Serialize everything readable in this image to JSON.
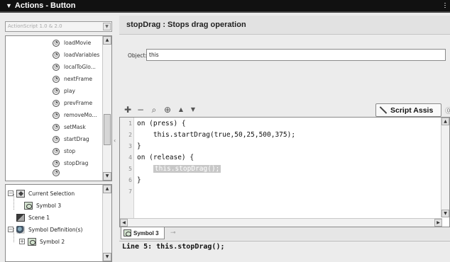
{
  "panel": {
    "title": "Actions - Button"
  },
  "version_select": {
    "value": "ActionScript 1.0 & 2.0"
  },
  "actions_list": {
    "items": [
      "loadMovie",
      "loadVariables",
      "localToGlo...",
      "nextFrame",
      "play",
      "prevFrame",
      "removeMo...",
      "setMask",
      "startDrag",
      "stop",
      "stopDrag"
    ]
  },
  "tree": {
    "current_selection": "Current Selection",
    "symbol3": "Symbol 3",
    "scene1": "Scene 1",
    "symbol_definitions": "Symbol Definition(s)",
    "symbol2": "Symbol 2"
  },
  "header": {
    "title": "stopDrag : Stops drag operation"
  },
  "object_field": {
    "label": "Object:",
    "value": "this"
  },
  "toolbar": {
    "script_assist_label": "Script Assis"
  },
  "editor": {
    "lines": [
      {
        "num": "1",
        "code": "on (press) {"
      },
      {
        "num": "2",
        "code": "    this.startDrag(true,50,25,500,375);"
      },
      {
        "num": "3",
        "code": "}"
      },
      {
        "num": "4",
        "code": "on (release) {"
      },
      {
        "num": "5",
        "code": "    ",
        "highlight": "this.stopDrag();"
      },
      {
        "num": "6",
        "code": "}"
      },
      {
        "num": "7",
        "code": ""
      }
    ]
  },
  "tab": {
    "label": "Symbol 3"
  },
  "status": {
    "text": "Line 5: this.stopDrag();"
  }
}
